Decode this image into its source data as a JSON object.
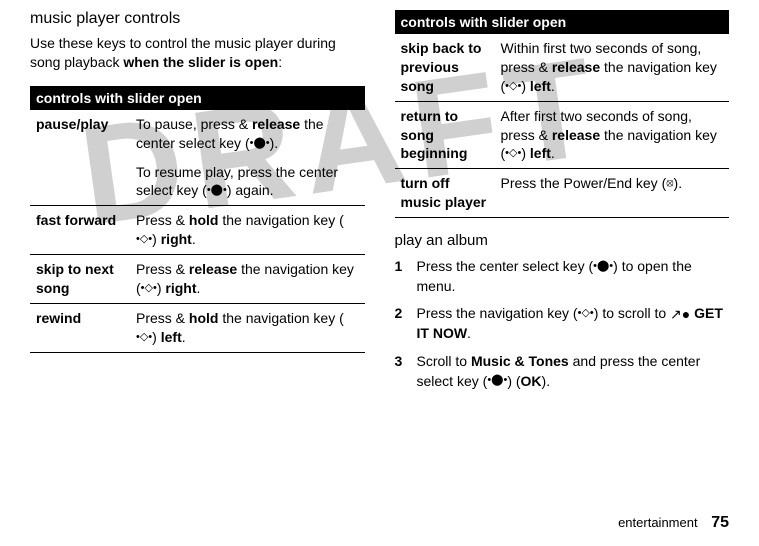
{
  "watermark": "DRAFT",
  "left": {
    "heading": "music player controls",
    "intro_pre": "Use these keys to control the music player during song playback ",
    "intro_bold": "when the slider is open",
    "intro_post": ":",
    "table_header": "controls with slider open",
    "rows": [
      {
        "label": "pause/play",
        "p1a": "To pause, press & ",
        "p1b": "release",
        "p1c": " the center select key (",
        "p1_glyph": "•⬤•",
        "p1d": ").",
        "p2a": "To resume play, press the center select key (",
        "p2_glyph": "•⬤•",
        "p2b": ") again."
      },
      {
        "label": "fast forward",
        "a": "Press & ",
        "b": "hold",
        "c": " the navigation key (",
        "glyph": "•◇•",
        "d": ") ",
        "e": "right",
        "f": "."
      },
      {
        "label": "skip to next song",
        "a": "Press & ",
        "b": "release",
        "c": " the navigation key (",
        "glyph": "•◇•",
        "d": ") ",
        "e": "right",
        "f": "."
      },
      {
        "label": "rewind",
        "a": "Press & ",
        "b": "hold",
        "c": " the navigation key (",
        "glyph": "•◇•",
        "d": ") ",
        "e": "left",
        "f": "."
      }
    ]
  },
  "right": {
    "table_header": "controls with slider open",
    "rows": [
      {
        "label": "skip back to previous song",
        "a": "Within first two seconds of song, press & ",
        "b": "release",
        "c": " the navigation key (",
        "glyph": "•◇•",
        "d": ") ",
        "e": "left",
        "f": "."
      },
      {
        "label": "return to song beginning",
        "a": "After first two seconds of song, press & ",
        "b": "release",
        "c": " the navigation key (",
        "glyph": "•◇•",
        "d": ") ",
        "e": "left",
        "f": "."
      },
      {
        "label": "turn off music player",
        "a": "Press the Power/End key (",
        "glyph": "⦻",
        "b": ")."
      }
    ],
    "sub_heading": "play an album",
    "steps": [
      {
        "num": "1",
        "a": "Press the center select key (",
        "glyph": "•⬤•",
        "b": ") to open the menu."
      },
      {
        "num": "2",
        "a": "Press the navigation key (",
        "glyph": "•◇•",
        "b": ") to scroll to ",
        "icon": "↗●",
        "menu": " GET IT NOW",
        "c": "."
      },
      {
        "num": "3",
        "a": "Scroll to ",
        "menu1": "Music & Tones",
        "b": " and press the center select key (",
        "glyph": "•⬤•",
        "c": ") (",
        "menu2": "OK",
        "d": ")."
      }
    ]
  },
  "footer": {
    "section": "entertainment",
    "page": "75"
  }
}
